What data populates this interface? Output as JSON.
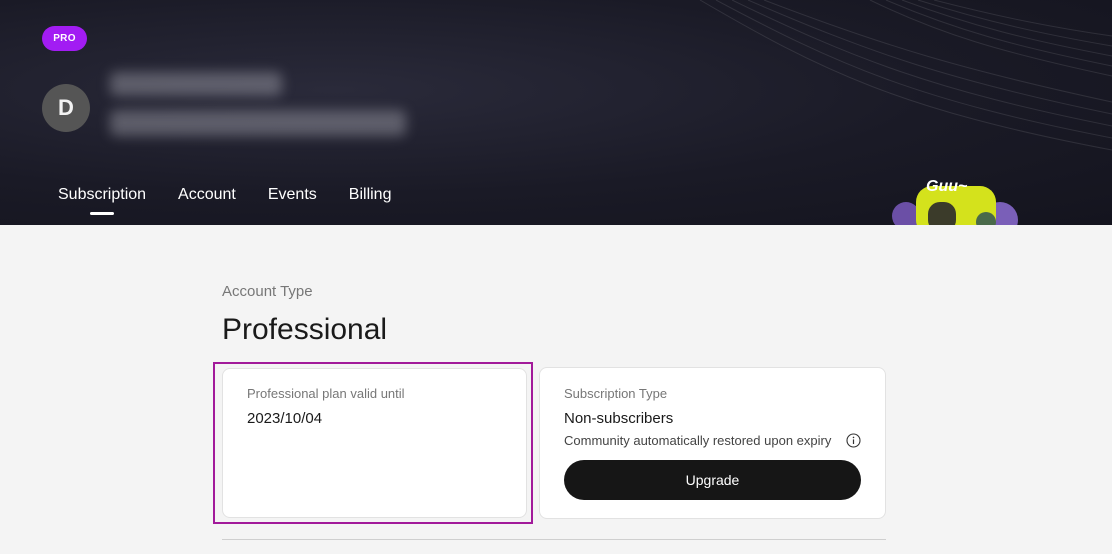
{
  "header": {
    "badge": "PRO",
    "avatar_initial": "D",
    "mascot_text": "Guu~"
  },
  "tabs": [
    {
      "label": "Subscription",
      "active": true
    },
    {
      "label": "Account",
      "active": false
    },
    {
      "label": "Events",
      "active": false
    },
    {
      "label": "Billing",
      "active": false
    }
  ],
  "account": {
    "type_label": "Account Type",
    "type_value": "Professional"
  },
  "plan_card": {
    "label": "Professional plan valid until",
    "value": "2023/10/04"
  },
  "subscription_card": {
    "label": "Subscription Type",
    "value": "Non-subscribers",
    "note": "Community automatically restored upon expiry",
    "button": "Upgrade"
  },
  "colors": {
    "badge": "#a21cf3",
    "highlight": "#a21a9a",
    "button": "#161616"
  }
}
